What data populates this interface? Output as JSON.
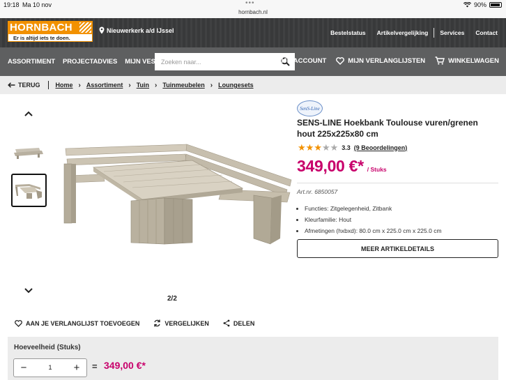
{
  "status_bar": {
    "time": "19:18",
    "date": "Ma 10 nov",
    "url": "hornbach.nl",
    "battery": "90%"
  },
  "header": {
    "logo_text": "HORNBACH",
    "logo_tagline": "Er is altijd iets te doen.",
    "store": "Nieuwerkerk a/d IJssel",
    "links": [
      "Bestelstatus",
      "Artikelvergelijking",
      "Services",
      "Contact"
    ]
  },
  "nav": {
    "items": [
      "ASSORTIMENT",
      "PROJECTADVIES",
      "MIJN VESTIGING"
    ],
    "search_placeholder": "Zoeken naar...",
    "account": "MIJN ACCOUNT",
    "wishlists": "MIJN VERLANGLIJSTEN",
    "cart": "WINKELWAGEN"
  },
  "breadcrumb": {
    "back": "TERUG",
    "items": [
      "Home",
      "Assortiment",
      "Tuin",
      "Tuinmeubelen",
      "Loungesets"
    ]
  },
  "gallery": {
    "counter": "2/2"
  },
  "product": {
    "brand": "SenS-Line",
    "title": "SENS-LINE Hoekbank Toulouse vuren/grenen hout 225x225x80 cm",
    "rating": 3.3,
    "rating_text": "3.3",
    "reviews": "(9 Beoordelingen)",
    "price": "349,00 €*",
    "unit": "/ Stuks",
    "article_nr": "Art.nr. 6850057",
    "features": [
      "Functies: Zitgelegenheid, Zitbank",
      "Kleurfamilie: Hout",
      "Afmetingen (hxbxd): 80.0 cm x 225.0 cm x 225.0 cm"
    ],
    "details_button": "MEER ARTIKELDETAILS"
  },
  "actions": {
    "wishlist": "AAN JE VERLANGLIJST TOEVOEGEN",
    "compare": "VERGELIJKEN",
    "share": "DELEN"
  },
  "quantity": {
    "label": "Hoeveelheid (Stuks)",
    "value": "1",
    "eq": "=",
    "total": "349,00 €*"
  },
  "colors": {
    "brand_orange": "#f29100",
    "price_magenta": "#c8006b",
    "header_dark": "#3a3b3c",
    "nav_gray": "#5e5f60"
  }
}
